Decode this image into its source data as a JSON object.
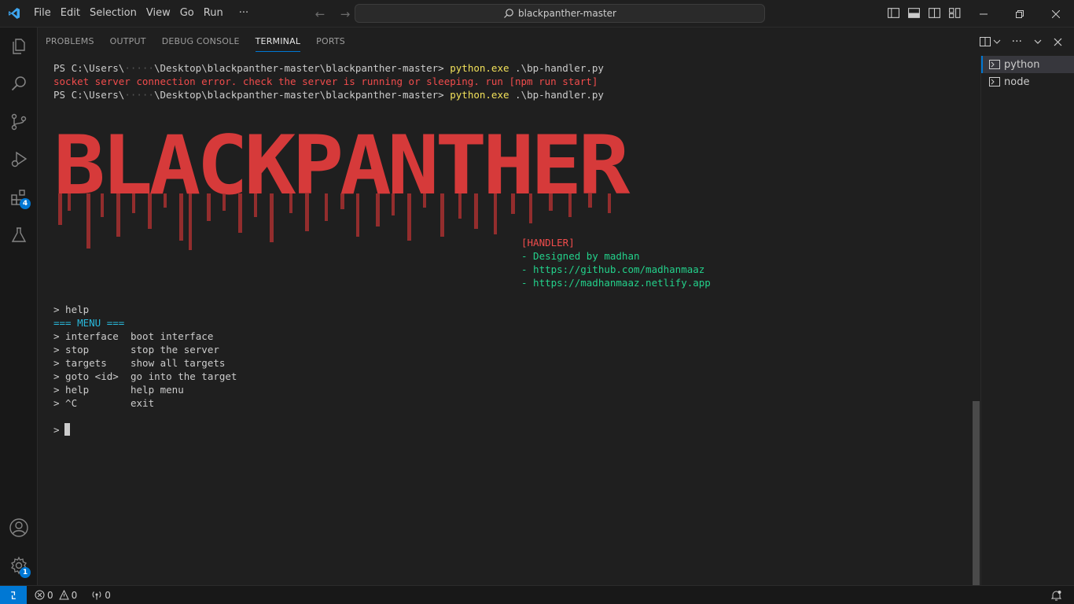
{
  "menu": [
    "File",
    "Edit",
    "Selection",
    "View",
    "Go",
    "Run",
    "···"
  ],
  "command_center": {
    "text": "blackpanther-master"
  },
  "activity": {
    "extensions_badge": "4",
    "manage_badge": "1"
  },
  "panel": {
    "tabs": [
      "PROBLEMS",
      "OUTPUT",
      "DEBUG CONSOLE",
      "TERMINAL",
      "PORTS"
    ],
    "active_tab": "TERMINAL"
  },
  "terminal": {
    "line1": {
      "prompt": "PS C:\\Users\\",
      "redacted": "·····",
      "path": "\\Desktop\\blackpanther-master\\blackpanther-master> ",
      "cmd": "python.exe",
      "arg": " .\\bp-handler.py"
    },
    "error": "socket server connection error. check the server is running or sleeping. run [npm run start]",
    "line2": {
      "prompt": "PS C:\\Users\\",
      "redacted": "·····",
      "path": "\\Desktop\\blackpanther-master\\blackpanther-master> ",
      "cmd": "python.exe",
      "arg": " .\\bp-handler.py"
    },
    "banner": "BLACKPANTHER",
    "handler_tag": "[HANDLER]",
    "credits": [
      "- Designed by madhan",
      "- https://github.com/madhanmaaz",
      "- https://madhanmaaz.netlify.app"
    ],
    "help_cmd": "> help",
    "menu_header": "=== MENU ===",
    "menu_rows": [
      {
        "cmd": "> interface",
        "desc": "boot interface"
      },
      {
        "cmd": "> stop",
        "desc": "stop the server"
      },
      {
        "cmd": "> targets",
        "desc": "show all targets"
      },
      {
        "cmd": "> goto <id>",
        "desc": "go into the target"
      },
      {
        "cmd": "> help",
        "desc": "help menu"
      },
      {
        "cmd": "> ^C",
        "desc": "exit"
      }
    ],
    "input_prompt": ">"
  },
  "terminal_list": [
    "python",
    "node"
  ],
  "statusbar": {
    "errors": "0",
    "warnings": "0",
    "ports": "0"
  },
  "colors": {
    "accent": "#0078d4",
    "banner_red": "#d63a3a",
    "yellow": "#f1e05a",
    "green": "#23d18b",
    "blue": "#29b8db",
    "error_red": "#f14c4c"
  }
}
